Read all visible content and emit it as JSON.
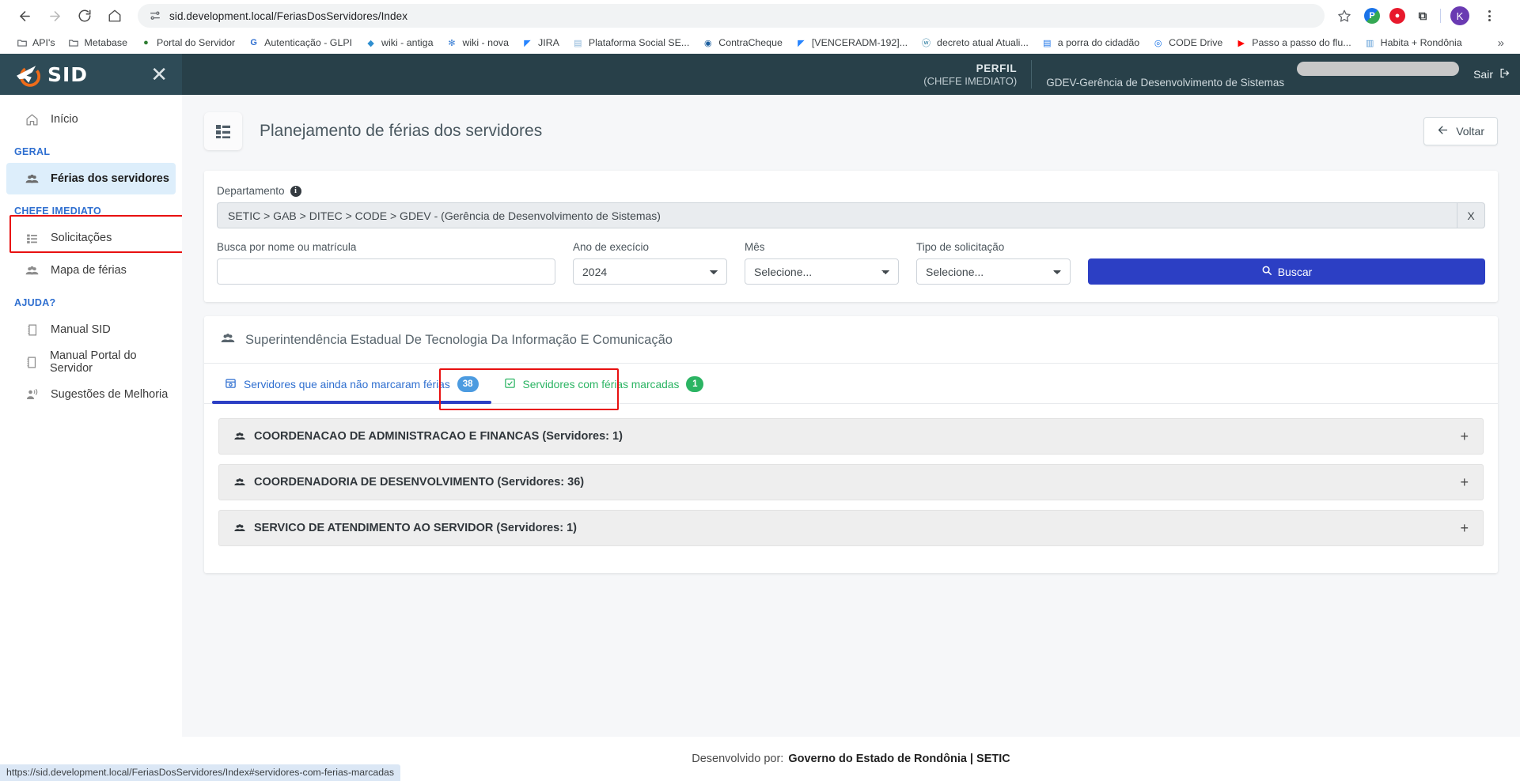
{
  "browser": {
    "url": "sid.development.local/FeriasDosServidores/Index",
    "back_icon": "arrow-left-icon",
    "forward_icon": "arrow-right-icon",
    "reload_icon": "reload-icon",
    "home_icon": "home-icon",
    "site_info_icon": "site-settings-icon",
    "star_icon": "bookmark-star-icon",
    "profile_initial": "K",
    "menu_icon": "kebab-menu-icon",
    "bookmarks": [
      {
        "label": "API's",
        "icon": "folder-icon",
        "type": "folder"
      },
      {
        "label": "Metabase",
        "icon": "folder-icon",
        "type": "folder"
      },
      {
        "label": "Portal do Servidor",
        "icon": "site-icon",
        "type": "site"
      },
      {
        "label": "Autenticação - GLPI",
        "icon": "glpi-icon",
        "type": "site"
      },
      {
        "label": "wiki - antiga",
        "icon": "wiki-icon",
        "type": "site"
      },
      {
        "label": "wiki - nova",
        "icon": "wiki-nova-icon",
        "type": "site"
      },
      {
        "label": "JIRA",
        "icon": "jira-icon",
        "type": "site"
      },
      {
        "label": "Plataforma Social SE...",
        "icon": "doc-icon",
        "type": "site"
      },
      {
        "label": "ContraCheque",
        "icon": "globe-icon",
        "type": "site"
      },
      {
        "label": "[VENCERADM-192]...",
        "icon": "jira-icon",
        "type": "site"
      },
      {
        "label": "decreto atual Atuali...",
        "icon": "wordpress-icon",
        "type": "site"
      },
      {
        "label": "a porra do cidadão",
        "icon": "list-icon",
        "type": "site"
      },
      {
        "label": "CODE Drive",
        "icon": "drive-icon",
        "type": "site"
      },
      {
        "label": "Passo a passo do flu...",
        "icon": "youtube-icon",
        "type": "site"
      },
      {
        "label": "Habita + Rondônia",
        "icon": "habita-icon",
        "type": "site"
      }
    ],
    "overflow_label": "»",
    "status_url": "https://sid.development.local/FeriasDosServidores/Index#servidores-com-ferias-marcadas"
  },
  "topbar": {
    "brand": "SID",
    "brand_icon": "plane-logo-icon",
    "close_icon": "close-icon",
    "perfil_title": "PERFIL",
    "perfil_sub": "(CHEFE IMEDIATO)",
    "department": "GDEV-Gerência de Desenvolvimento de Sistemas",
    "logout_label": "Sair",
    "logout_icon": "logout-icon"
  },
  "sidebar": {
    "home": {
      "label": "Início",
      "icon": "home-icon"
    },
    "sections": [
      {
        "title": "GERAL",
        "items": [
          {
            "label": "Férias dos servidores",
            "icon": "users-icon",
            "active": true
          }
        ]
      },
      {
        "title": "CHEFE IMEDIATO",
        "items": [
          {
            "label": "Solicitações",
            "icon": "list-icon",
            "active": false
          },
          {
            "label": "Mapa de férias",
            "icon": "users-icon",
            "active": false
          }
        ]
      },
      {
        "title": "AJUDA?",
        "items": [
          {
            "label": "Manual SID",
            "icon": "book-icon",
            "active": false
          },
          {
            "label": "Manual Portal do Servidor",
            "icon": "book-icon",
            "active": false
          },
          {
            "label": "Sugestões de Melhoria",
            "icon": "megaphone-icon",
            "active": false
          }
        ]
      }
    ]
  },
  "page": {
    "title": "Planejamento de férias dos servidores",
    "title_icon": "list-grid-icon",
    "back_label": "Voltar",
    "back_icon": "arrow-left-icon"
  },
  "filters": {
    "department_label": "Departamento",
    "department_info_icon": "info-icon",
    "department_value": "SETIC > GAB > DITEC > CODE > GDEV - (Gerência de Desenvolvimento de Sistemas)",
    "department_clear_label": "X",
    "search_label": "Busca por nome ou matrícula",
    "search_value": "",
    "search_placeholder": "",
    "year_label": "Ano de execício",
    "year_value": "2024",
    "year_options": [
      "2024"
    ],
    "month_label": "Mês",
    "month_value": "Selecione...",
    "month_options": [
      "Selecione..."
    ],
    "request_type_label": "Tipo de solicitação",
    "request_type_value": "Selecione...",
    "request_type_options": [
      "Selecione..."
    ],
    "search_button_label": "Buscar",
    "search_button_icon": "search-icon"
  },
  "results": {
    "heading": "Superintendência Estadual De Tecnologia Da Informação E Comunicação",
    "heading_icon": "users-icon",
    "tabs": [
      {
        "label": "Servidores que ainda não marcaram férias",
        "count": "38",
        "icon": "calendar-pending-icon",
        "active": true,
        "badge_color": "#4c9be0"
      },
      {
        "label": "Servidores com férias marcadas",
        "count": "1",
        "icon": "calendar-check-icon",
        "active": false,
        "badge_color": "#2bb463"
      }
    ],
    "groups": [
      {
        "label": "COORDENACAO DE ADMINISTRACAO E FINANCAS (Servidores: 1)",
        "icon": "users-icon",
        "expand": "+"
      },
      {
        "label": "COORDENADORIA DE DESENVOLVIMENTO (Servidores: 36)",
        "icon": "users-icon",
        "expand": "+"
      },
      {
        "label": "SERVICO DE ATENDIMENTO AO SERVIDOR (Servidores: 1)",
        "icon": "users-icon",
        "expand": "+"
      }
    ]
  },
  "footer": {
    "prefix": "Desenvolvido por:",
    "org": "Governo do Estado de Rondônia | SETIC"
  },
  "colors": {
    "primary": "#2c3fc4",
    "topbar": "#2b4450",
    "accent_link": "#2f6fd0",
    "highlight_border": "#e81010",
    "badge_blue": "#4c9be0",
    "badge_green": "#2bb463"
  }
}
